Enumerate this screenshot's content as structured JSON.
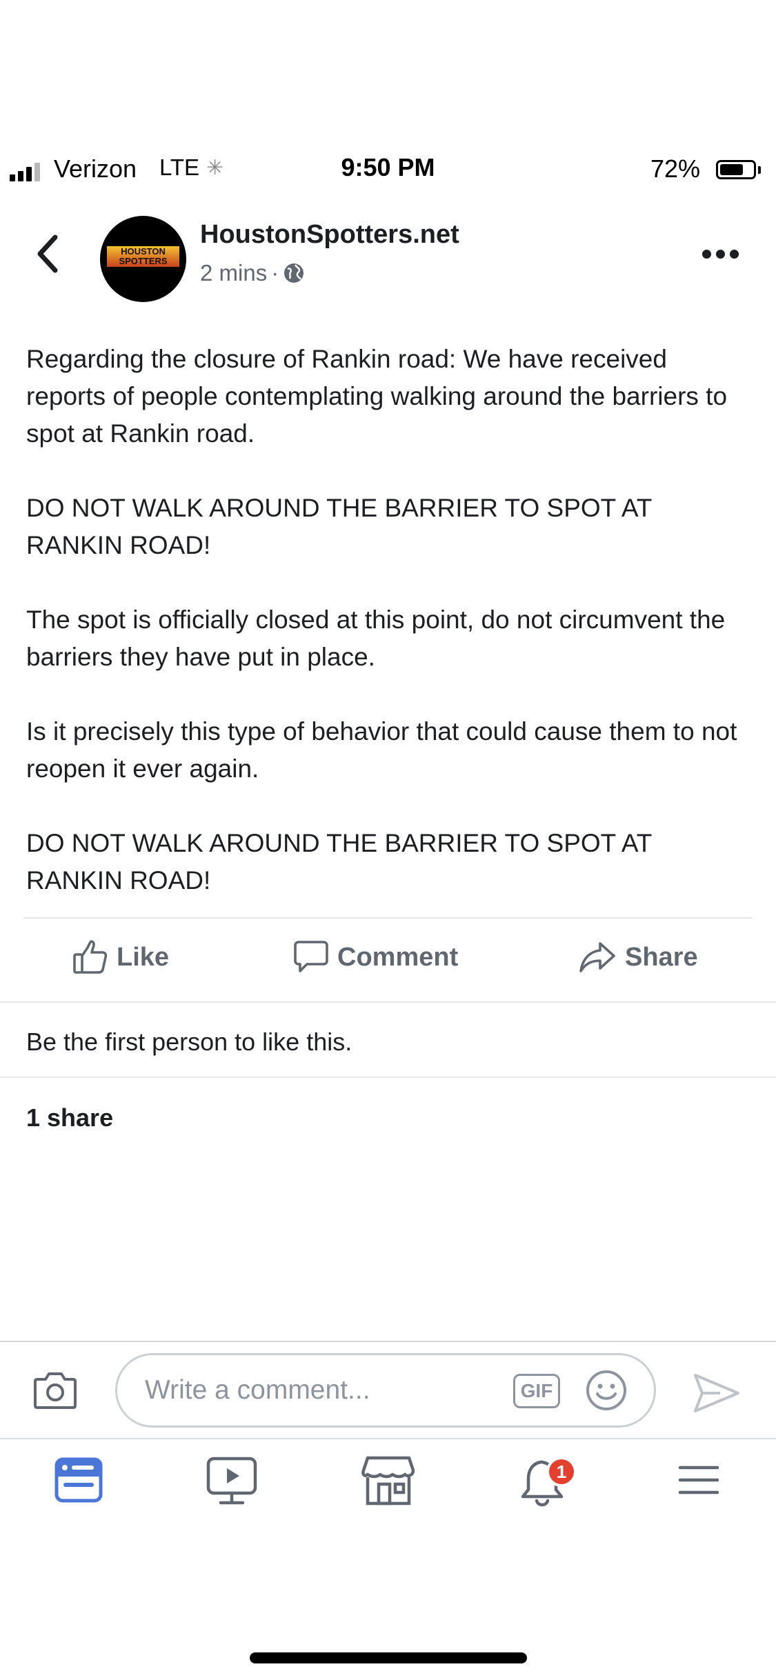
{
  "status_bar": {
    "carrier": "Verizon",
    "network": "LTE",
    "time": "9:50 PM",
    "battery_percent": "72%",
    "battery_level": 0.72,
    "signal_bars": 3
  },
  "header": {
    "page_name": "HoustonSpotters.net",
    "post_age": "2 mins",
    "separator": "·",
    "audience_icon": "globe-icon",
    "avatar_text_lines": [
      "HOUSTON",
      "SPOTTERS"
    ],
    "back_icon": "chevron-left-icon",
    "more_icon": "more-dots-icon"
  },
  "post": {
    "paragraphs": [
      "Regarding the closure of Rankin road: We have received reports of people contemplating walking around the barriers to spot at Rankin road.",
      "DO NOT WALK AROUND THE BARRIER TO SPOT AT RANKIN ROAD!",
      "The spot is officially closed at this point, do not circumvent the barriers they have put in place.",
      "Is it precisely this type of behavior that could cause them to not reopen it ever again.",
      "DO NOT WALK AROUND THE BARRIER TO SPOT AT RANKIN ROAD!"
    ]
  },
  "actions": {
    "like_label": "Like",
    "comment_label": "Comment",
    "share_label": "Share"
  },
  "engagement": {
    "likes_text": "Be the first person to like this.",
    "shares_text": "1 share"
  },
  "composer": {
    "placeholder": "Write a comment...",
    "gif_label": "GIF",
    "camera_icon": "camera-icon",
    "emoji_icon": "emoji-icon",
    "send_icon": "send-icon"
  },
  "bottom_nav": {
    "tabs": [
      {
        "icon": "news-feed-icon",
        "active": true
      },
      {
        "icon": "watch-icon",
        "active": false
      },
      {
        "icon": "marketplace-icon",
        "active": false
      },
      {
        "icon": "notifications-icon",
        "active": false,
        "badge": "1"
      },
      {
        "icon": "menu-icon",
        "active": false
      }
    ]
  },
  "colors": {
    "accent_blue": "#4a76d8",
    "badge_red": "#e4402f",
    "secondary_text": "#606770"
  }
}
